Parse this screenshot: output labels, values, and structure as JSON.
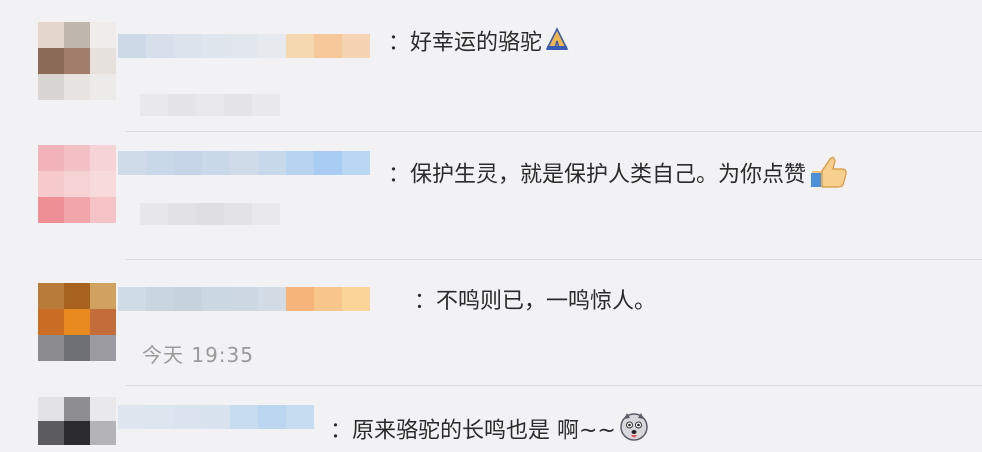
{
  "comments": [
    {
      "text": "：好幸运的骆驼",
      "emoji": "folded-hands-icon"
    },
    {
      "text": "：保护生灵，就是保护人类自己。为你点赞",
      "emoji": "thumbs-up-icon"
    },
    {
      "text": "：不鸣则已，一鸣惊人。",
      "emoji": "",
      "timestamp": "今天 19:35"
    },
    {
      "text": "：原来骆驼的长鸣也是 啊~~",
      "emoji": "husky-face-icon"
    }
  ]
}
